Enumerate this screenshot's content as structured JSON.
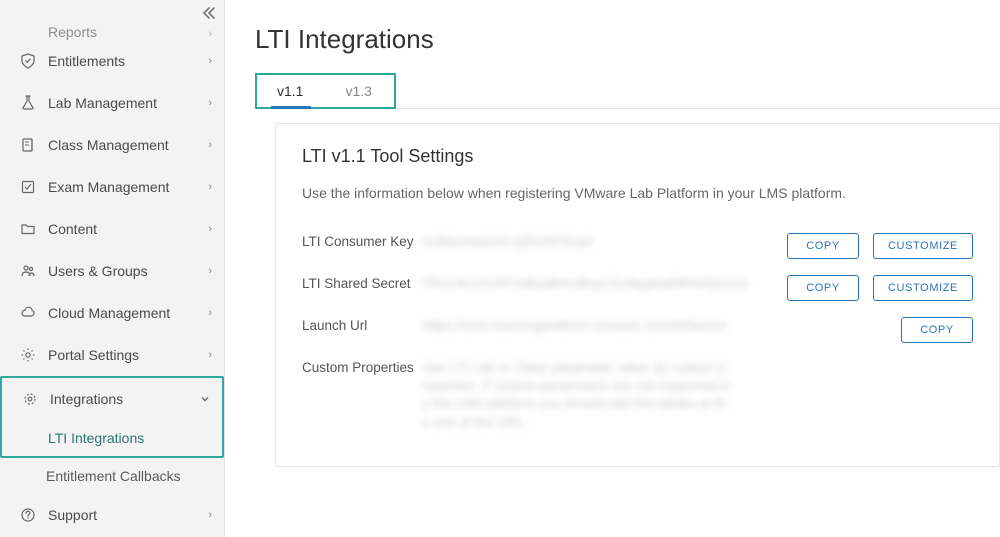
{
  "sidebar": {
    "items": [
      {
        "label": "Reports",
        "icon": "reports",
        "truncated": true
      },
      {
        "label": "Entitlements",
        "icon": "shield-check"
      },
      {
        "label": "Lab Management",
        "icon": "flask"
      },
      {
        "label": "Class Management",
        "icon": "book"
      },
      {
        "label": "Exam Management",
        "icon": "exam"
      },
      {
        "label": "Content",
        "icon": "folder"
      },
      {
        "label": "Users & Groups",
        "icon": "users"
      },
      {
        "label": "Cloud Management",
        "icon": "cloud"
      },
      {
        "label": "Portal Settings",
        "icon": "gear"
      },
      {
        "label": "Integrations",
        "icon": "integrations",
        "expanded": true,
        "subitems": [
          {
            "label": "LTI Integrations",
            "active": true
          },
          {
            "label": "Entitlement Callbacks"
          }
        ]
      },
      {
        "label": "Support",
        "icon": "help"
      }
    ]
  },
  "main": {
    "title": "LTI Integrations",
    "tabs": [
      {
        "label": "v1.1",
        "active": true
      },
      {
        "label": "v1.3"
      }
    ],
    "card": {
      "title": "LTI v1.1 Tool Settings",
      "description": "Use the information below when registering VMware Lab Platform in your LMS platform.",
      "rows": [
        {
          "label": "LTI Consumer Key",
          "value": "oc8ktomwlz3V-q35URF5zqX",
          "actions": [
            "COPY",
            "CUSTOMIZE"
          ]
        },
        {
          "label": "LTI Shared Secret",
          "value": "TRcv.lkU2XAPVoBysBHrsBnpCSz9qqNy89Ro0QvUve",
          "actions": [
            "COPY",
            "CUSTOMIZE"
          ]
        },
        {
          "label": "Launch Url",
          "value": "https://core.learningplatform.vmware.com/lti/launch",
          "actions": [
            "COPY"
          ]
        },
        {
          "label": "Custom Properties",
          "value": "Use LTI Lab or Class parameter value as custom properties. If custom parameters are not supported by the LMS platform you should add the labsku at the end of the URL.",
          "actions": []
        }
      ]
    }
  },
  "buttons": {
    "copy": "COPY",
    "customize": "CUSTOMIZE"
  }
}
